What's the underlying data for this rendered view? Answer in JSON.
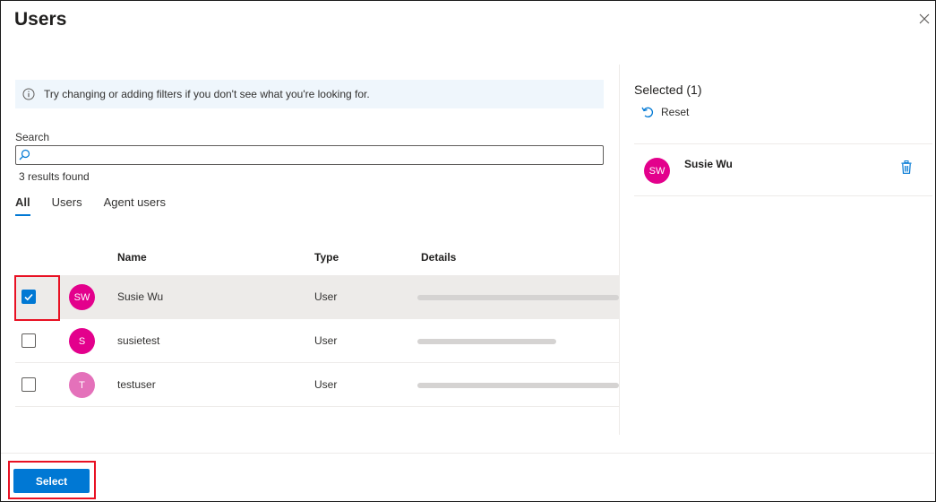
{
  "dialog": {
    "title": "Users"
  },
  "info_bar": {
    "icon": "info-icon",
    "text": "Try changing or adding filters if you don't see what you're looking for."
  },
  "search": {
    "label": "Search",
    "value": "",
    "icon": "search-icon",
    "results_text": "3 results found"
  },
  "tabs": [
    {
      "label": "All",
      "active": true
    },
    {
      "label": "Users",
      "active": false
    },
    {
      "label": "Agent users",
      "active": false
    }
  ],
  "table": {
    "columns": {
      "name": "Name",
      "type": "Type",
      "details": "Details"
    },
    "rows": [
      {
        "initials": "SW",
        "avatar_color": "#e3008c",
        "name": "Susie Wu",
        "type": "User",
        "checked": true,
        "details_redacted": true
      },
      {
        "initials": "S",
        "avatar_color": "#e3008c",
        "name": "susietest",
        "type": "User",
        "checked": false,
        "details_redacted": true
      },
      {
        "initials": "T",
        "avatar_color": "#e471ba",
        "name": "testuser",
        "type": "User",
        "checked": false,
        "details_redacted": true
      }
    ]
  },
  "selected_panel": {
    "title": "Selected (1)",
    "reset_label": "Reset",
    "items": [
      {
        "initials": "SW",
        "avatar_color": "#e3008c",
        "name": "Susie Wu"
      }
    ]
  },
  "footer": {
    "select_label": "Select"
  },
  "colors": {
    "accent": "#0078d4",
    "highlight": "#e81123",
    "info_bg": "#eff6fc"
  }
}
